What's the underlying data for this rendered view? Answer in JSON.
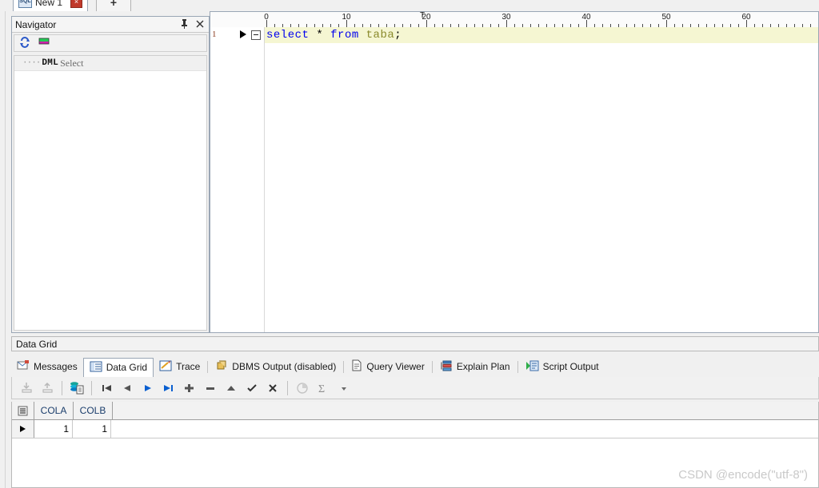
{
  "window": {
    "tab": {
      "icon": "sql-file-icon",
      "label": "New 1",
      "close_label": "×",
      "new_tab_label": "+"
    }
  },
  "navigator": {
    "title": "Navigator",
    "pin_icon": "pin-icon",
    "close_icon": "close-icon",
    "toolbar": {
      "refresh_icon": "refresh-icon",
      "object_icon": "object-color-icon"
    },
    "tree": {
      "dashes": "····",
      "group": "DML",
      "item": "Select"
    }
  },
  "editor": {
    "ruler": {
      "labels": [
        "0",
        "10",
        "20",
        "30",
        "40",
        "50",
        "60"
      ],
      "tab_marker": "T"
    },
    "line_number": "1",
    "code": {
      "full": "select * from taba;",
      "tokens": [
        {
          "text": "select",
          "type": "keyword",
          "color": "#0000ee"
        },
        {
          "text": " ",
          "type": "space",
          "color": "#000000"
        },
        {
          "text": "*",
          "type": "operator",
          "color": "#000000"
        },
        {
          "text": " ",
          "type": "space",
          "color": "#000000"
        },
        {
          "text": "from",
          "type": "keyword",
          "color": "#0000ee"
        },
        {
          "text": " ",
          "type": "space",
          "color": "#000000"
        },
        {
          "text": "taba",
          "type": "identifier",
          "color": "#8a8a2b"
        },
        {
          "text": ";",
          "type": "punctuation",
          "color": "#000000"
        }
      ]
    },
    "current_line_bg": "#f5f6d2"
  },
  "dock": {
    "title": "Data Grid",
    "tabs": [
      {
        "label": "Messages",
        "icon": "messages-icon",
        "active": false
      },
      {
        "label": "Data Grid",
        "icon": "data-grid-icon",
        "active": true
      },
      {
        "label": "Trace",
        "icon": "trace-icon",
        "active": false
      },
      {
        "label": "DBMS Output (disabled)",
        "icon": "dbms-output-icon",
        "active": false
      },
      {
        "label": "Query Viewer",
        "icon": "query-viewer-icon",
        "active": false
      },
      {
        "label": "Explain Plan",
        "icon": "explain-plan-icon",
        "active": false
      },
      {
        "label": "Script Output",
        "icon": "script-output-icon",
        "active": false
      }
    ],
    "toolbar": [
      {
        "name": "import-data-icon",
        "enabled": false
      },
      {
        "name": "export-data-icon",
        "enabled": false
      },
      {
        "name": "single-record-view-icon",
        "enabled": true
      },
      {
        "name": "first-record-icon",
        "enabled": true
      },
      {
        "name": "previous-record-icon",
        "enabled": true
      },
      {
        "name": "next-record-icon",
        "enabled": true
      },
      {
        "name": "last-record-icon",
        "enabled": true
      },
      {
        "name": "insert-record-icon",
        "enabled": true
      },
      {
        "name": "delete-record-icon",
        "enabled": true
      },
      {
        "name": "revert-record-icon",
        "enabled": true
      },
      {
        "name": "post-record-icon",
        "enabled": true
      },
      {
        "name": "cancel-edit-icon",
        "enabled": true
      },
      {
        "name": "chart-icon",
        "enabled": false
      },
      {
        "name": "sum-sigma-icon",
        "enabled": true
      },
      {
        "name": "dropdown-arrow-icon",
        "enabled": true
      }
    ],
    "grid": {
      "columns": [
        "COLA",
        "COLB"
      ],
      "rows": [
        {
          "marker": "▶",
          "cells": [
            "1",
            "1"
          ]
        }
      ]
    }
  },
  "watermark": "CSDN @encode(\"utf-8\")",
  "colors": {
    "keyword": "#0000ee",
    "identifier": "#8a8a2b",
    "current_line": "#f5f6d2",
    "panel_border": "#9aa6b5",
    "column_header_text": "#1a3d6b"
  }
}
